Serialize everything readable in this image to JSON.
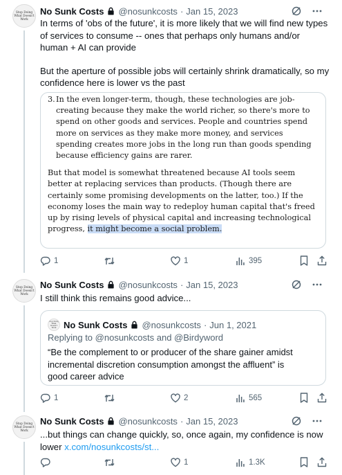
{
  "tweets": [
    {
      "avatar_text": [
        "Stop Doing",
        "What Doesn't",
        "Work"
      ],
      "name": "No Sunk Costs",
      "handle": "@nosunkcosts",
      "separator": "·",
      "date": "Jan 15, 2023",
      "text_p1": "In terms of 'obs of the future', it is more likely that we will find new types of services to consume -- ones that perhaps only humans and/or human + AI can provide",
      "text_p2": "But the aperture of possible jobs will certainly shrink dramatically, so my confidence here is lower vs the past",
      "quoted_image": {
        "item_number": "3.",
        "item_text": "In the even longer-term, though, these technologies are job-creating because they make the world richer, so there's more to spend on other goods and services. People and countries spend more on services as they make more money, and services spending creates more jobs in the long run than goods spending because efficiency gains are rarer.",
        "para2_text": "But that model is somewhat threatened because AI tools seem better at replacing services than products. (Though there are certainly some promising developments on the latter, too.) If the economy loses the main way to redeploy human capital that's freed up by rising levels of physical capital and increasing technological progress, ",
        "para2_highlight": "it might become a social problem."
      },
      "replies": "1",
      "retweets": "",
      "likes": "1",
      "views": "395"
    },
    {
      "avatar_text": [
        "Stop Doing",
        "What Doesn't",
        "Work"
      ],
      "name": "No Sunk Costs",
      "handle": "@nosunkcosts",
      "separator": "·",
      "date": "Jan 15, 2023",
      "text": "I still think this remains good advice...",
      "quoted_tweet": {
        "avatar_text": [
          "Stop Doing",
          "What Doesn't",
          "Work"
        ],
        "name": "No Sunk Costs",
        "handle": "@nosunkcosts",
        "separator": "·",
        "date": "Jun 1, 2021",
        "reply_prefix": "Replying to ",
        "reply_handle_1": "@nosunkcosts",
        "reply_and": " and ",
        "reply_handle_2": "@Birdyword",
        "text": "“Be the complement to or producer of the share gainer amidst incremental discretion consumption amongst the affluent” is good career advice"
      },
      "replies": "1",
      "retweets": "",
      "likes": "2",
      "views": "565"
    },
    {
      "avatar_text": [
        "Stop Doing",
        "What Doesn't",
        "Work"
      ],
      "name": "No Sunk Costs",
      "handle": "@nosunkcosts",
      "separator": "·",
      "date": "Jan 15, 2023",
      "text": "...but things can change quickly, so, once again, my confidence is now lower ",
      "link": "x.com/nosunkcosts/st...",
      "replies": "",
      "retweets": "",
      "likes": "1",
      "views": "1.3K"
    }
  ],
  "icons": {
    "lock": "lock-icon",
    "grok": "grok-icon",
    "more": "more-icon",
    "reply": "reply-icon",
    "retweet": "retweet-icon",
    "like": "like-icon",
    "views": "views-icon",
    "bookmark": "bookmark-icon",
    "share": "share-icon"
  },
  "colors": {
    "text": "#0f1419",
    "secondary": "#536471",
    "link": "#1d9bf0",
    "border": "#cfd9de",
    "highlight": "#c9dcf6"
  }
}
